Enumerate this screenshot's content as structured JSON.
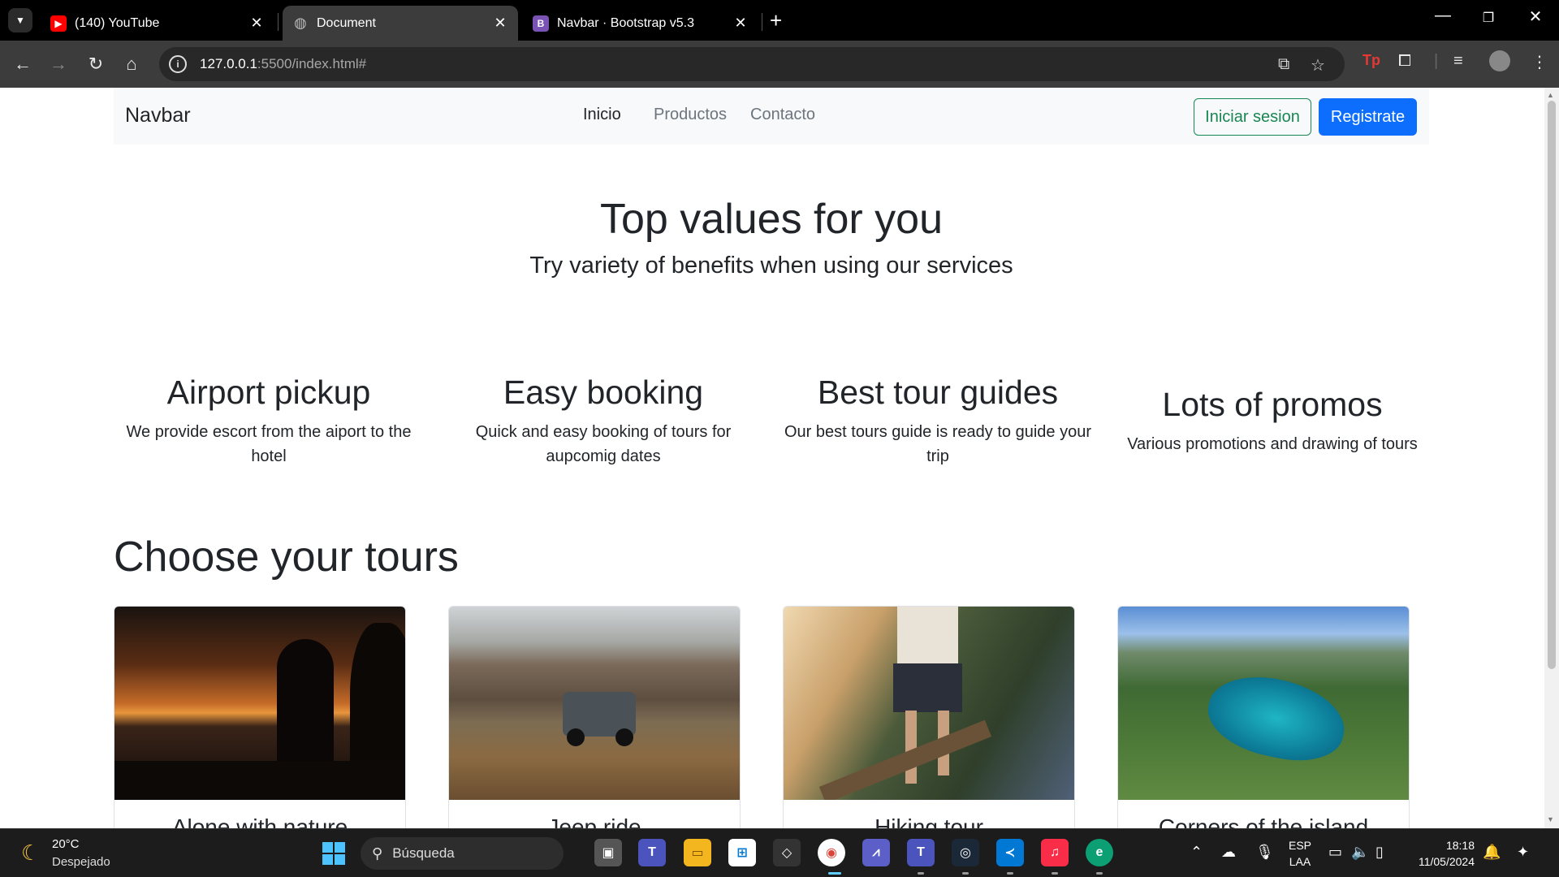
{
  "browser": {
    "tabs": [
      {
        "title": "(140) YouTube",
        "active": false
      },
      {
        "title": "Document",
        "active": true
      },
      {
        "title": "Navbar · Bootstrap v5.3",
        "active": false
      }
    ],
    "url_host": "127.0.0.1",
    "url_rest": ":5500/index.html#"
  },
  "page": {
    "brand": "Navbar",
    "nav_links": [
      "Inicio",
      "Productos",
      "Contacto"
    ],
    "login_label": "Iniciar sesion",
    "register_label": "Registrate",
    "hero_title": "Top values for you",
    "hero_subtitle": "Try variety of benefits when using our services",
    "features": [
      {
        "title": "Airport pickup",
        "text": "We provide escort from the aiport to the hotel"
      },
      {
        "title": "Easy booking",
        "text": "Quick and easy booking of tours for aupcomig dates"
      },
      {
        "title": "Best tour guides",
        "text": "Our best tours guide is ready to guide your trip"
      },
      {
        "title": "Lots of promos",
        "text": "Various promotions and drawing of tours"
      }
    ],
    "tours_title": "Choose your tours",
    "tours": [
      {
        "name": "Alone with nature"
      },
      {
        "name": "Jeep ride"
      },
      {
        "name": "Hiking tour"
      },
      {
        "name": "Corners of the island"
      }
    ]
  },
  "taskbar": {
    "temperature": "20°C",
    "weather": "Despejado",
    "search_placeholder": "Búsqueda",
    "lang_top": "ESP",
    "lang_bottom": "LAA",
    "time": "18:18",
    "date": "11/05/2024"
  },
  "colors": {
    "primary": "#0d6efd",
    "success": "#198754",
    "navbar_bg": "#f8f9fa"
  }
}
